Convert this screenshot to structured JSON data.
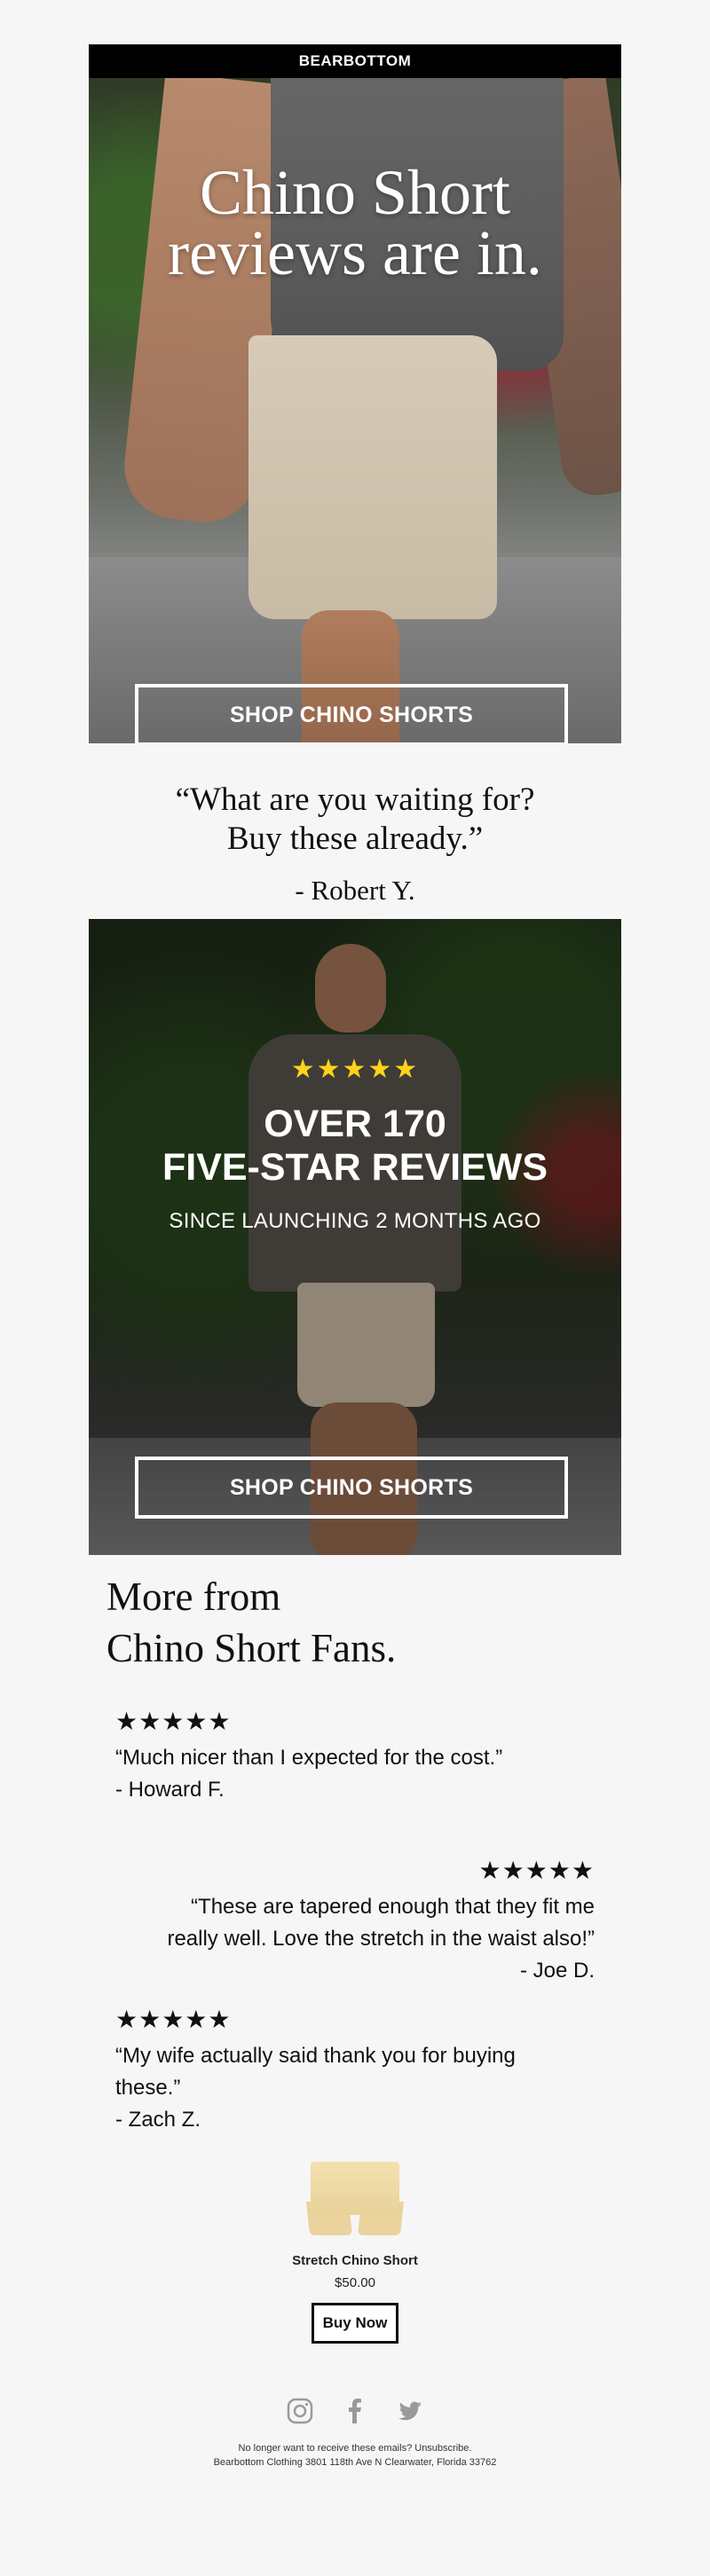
{
  "brand": {
    "name": "BEARBOTTOM"
  },
  "hero1": {
    "title_line1": "Chino Short",
    "title_line2": "reviews are in.",
    "cta": "SHOP CHINO SHORTS"
  },
  "quote": {
    "line1": "“What are you waiting for?",
    "line2": "Buy these already.”",
    "author": "- Robert Y."
  },
  "hero2": {
    "stars": "★★★★★",
    "line1": "OVER 170",
    "line2": "FIVE-STAR REVIEWS",
    "subtitle": "SINCE LAUNCHING 2 MONTHS AGO",
    "cta": "SHOP CHINO SHORTS"
  },
  "fans": {
    "title_line1": "More from",
    "title_line2": "Chino Short Fans.",
    "reviews": [
      {
        "stars": "★★★★★",
        "text": "“Much nicer than I expected for the cost.”",
        "author": "- Howard F."
      },
      {
        "stars": "★★★★★",
        "text": "“These are tapered enough that they fit me really well. Love the stretch in the waist also!”",
        "author": "- Joe D."
      },
      {
        "stars": "★★★★★",
        "text": "“My wife actually said thank you for buying these.”",
        "author": "- Zach Z."
      }
    ]
  },
  "product": {
    "name": "Stretch Chino Short",
    "price": "$50.00",
    "cta": "Buy Now"
  },
  "social": [
    "instagram-icon",
    "facebook-icon",
    "twitter-icon"
  ],
  "footer": {
    "unsubscribe": "No longer want to receive these emails? Unsubscribe.",
    "address": "Bearbottom Clothing 3801 118th Ave N Clearwater, Florida 33762"
  },
  "colors": {
    "star_yellow": "#ffd21a",
    "header_bg": "#000000",
    "page_bg": "#f6f6f6"
  }
}
